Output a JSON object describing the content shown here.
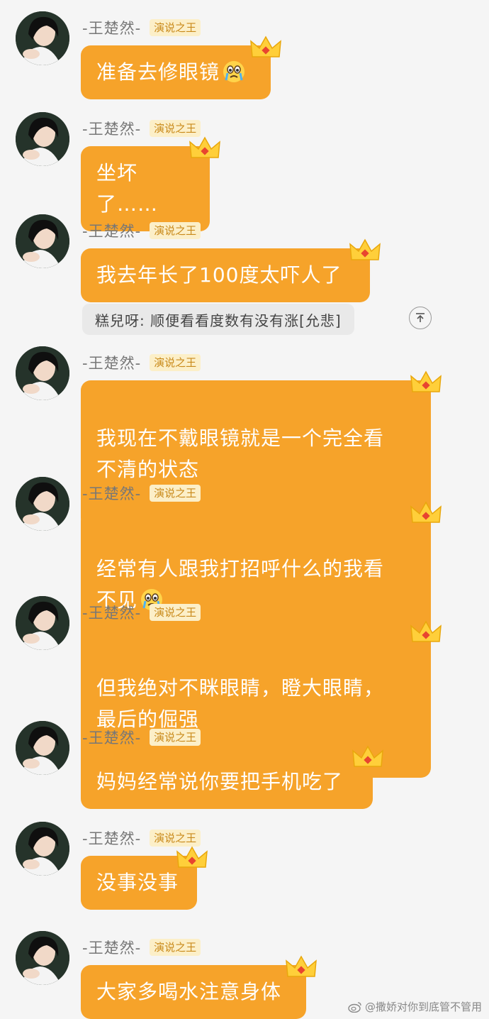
{
  "sender": {
    "name": "-王楚然-",
    "badge": "演说之王"
  },
  "messages": [
    {
      "text": "准备去修眼镜",
      "emoji": "crying-face"
    },
    {
      "text": "坐坏了……"
    },
    {
      "text": "我去年长了100度太吓人了"
    },
    {
      "text": "我现在不戴眼镜就是一个完全看\n不清的状态"
    },
    {
      "text": "经常有人跟我打招呼什么的我看\n不见",
      "emoji": "crying-face"
    },
    {
      "text": "但我绝对不眯眼睛，瞪大眼睛，\n最后的倔强"
    },
    {
      "text": "妈妈经常说你要把手机吃了"
    },
    {
      "text": "没事没事"
    },
    {
      "text": "大家多喝水注意身体"
    }
  ],
  "quote": {
    "text": "糕兒呀: 顺便看看度数有没有涨[允悲]",
    "button_icon": "arrow-up-to-top-icon"
  },
  "watermark": {
    "text": "@撒娇对你到底管不管用",
    "icon": "weibo-icon"
  },
  "colors": {
    "bubble": "#f6a32a",
    "badge_text": "#c98a1a",
    "badge_bg": "#fcefc8",
    "background": "#f5f5f5"
  }
}
